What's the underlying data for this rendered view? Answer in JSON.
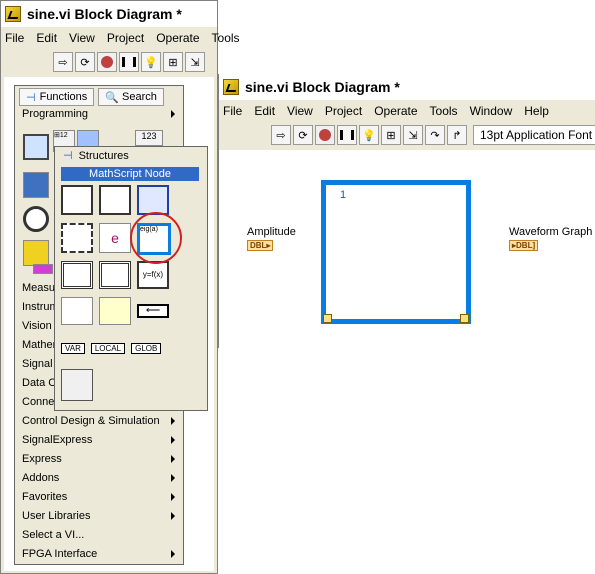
{
  "back_window": {
    "title": "sine.vi Block Diagram *",
    "menu": [
      "File",
      "Edit",
      "View",
      "Project",
      "Operate",
      "Tools"
    ]
  },
  "front_window": {
    "title": "sine.vi Block Diagram *",
    "menu": [
      "File",
      "Edit",
      "View",
      "Project",
      "Operate",
      "Tools",
      "Window",
      "Help"
    ],
    "font_select": "13pt Application Font",
    "amplitude_label": "Amplitude",
    "amplitude_type": "DBL",
    "graph_label": "Waveform Graph",
    "graph_type": "DBL",
    "node_value": "1",
    "colors": {
      "accent": "#0a7ee0",
      "highlight": "#316ac5",
      "circle": "#d02020"
    }
  },
  "functions_palette": {
    "tab_functions": "Functions",
    "tab_search": "Search",
    "category": "Programming",
    "items": [
      "Measure",
      "Instrum",
      "Vision a",
      "Mathem",
      "Signal P",
      "Data C",
      "Connec",
      "Control Design & Simulation",
      "SignalExpress",
      "Express",
      "Addons",
      "Favorites",
      "User Libraries",
      "Select a VI...",
      "FPGA Interface"
    ],
    "items_with_arrow": [
      true,
      true,
      true,
      true,
      true,
      true,
      true,
      true,
      true,
      true,
      true,
      true,
      true,
      false,
      true
    ]
  },
  "structures_palette": {
    "title": "Structures",
    "highlight_label": "MathScript Node",
    "var_labels": [
      "VAR",
      "LOCAL",
      "GLOB"
    ]
  }
}
